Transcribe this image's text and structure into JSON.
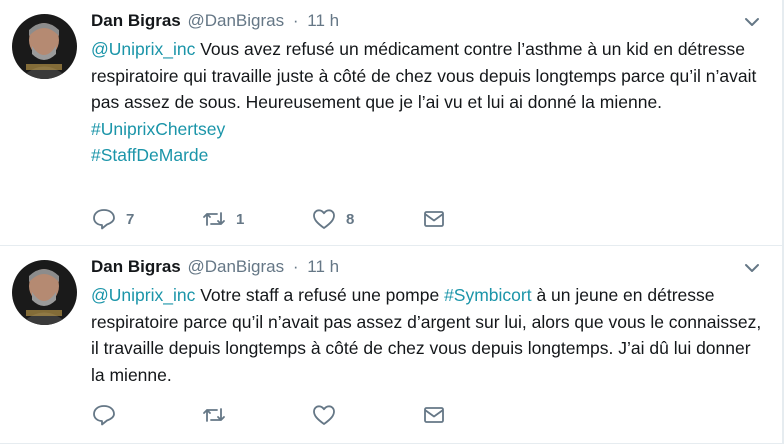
{
  "tweets": [
    {
      "author_name": "Dan Bigras",
      "author_handle": "@DanBigras",
      "separator": "·",
      "time": "11 h",
      "mention": "@Uniprix_inc",
      "text": " Vous avez refusé un médicament contre l’asthme à un kid en détresse respiratoire qui travaille juste à côté de chez vous depuis longtemps parce qu’il n’avait pas assez de sous. Heureusement que je l’ai vu et lui ai donné la mienne.",
      "hashtag1": "#UniprixChertsey",
      "hashtag2": "#StaffDeMarde",
      "reply_count": "7",
      "retweet_count": "1",
      "like_count": "8"
    },
    {
      "author_name": "Dan Bigras",
      "author_handle": "@DanBigras",
      "separator": "·",
      "time": "11 h",
      "mention": "@Uniprix_inc",
      "text_before": " Votre staff a refusé une pompe ",
      "hashtag": "#Symbicort",
      "text_after": " à un jeune en détresse respiratoire parce qu’il n’avait pas assez d’argent sur lui, alors que vous le connaissez, il travaille depuis longtemps à côté de chez vous depuis longtemps. J’ai dû lui donner la mienne."
    }
  ],
  "icons": [
    "reply-icon",
    "retweet-icon",
    "like-icon",
    "message-icon",
    "chevron-down-icon"
  ],
  "colors": {
    "link": "#1b95a9",
    "text": "#14171a",
    "muted": "#657786",
    "divider": "#e6ecf0"
  }
}
